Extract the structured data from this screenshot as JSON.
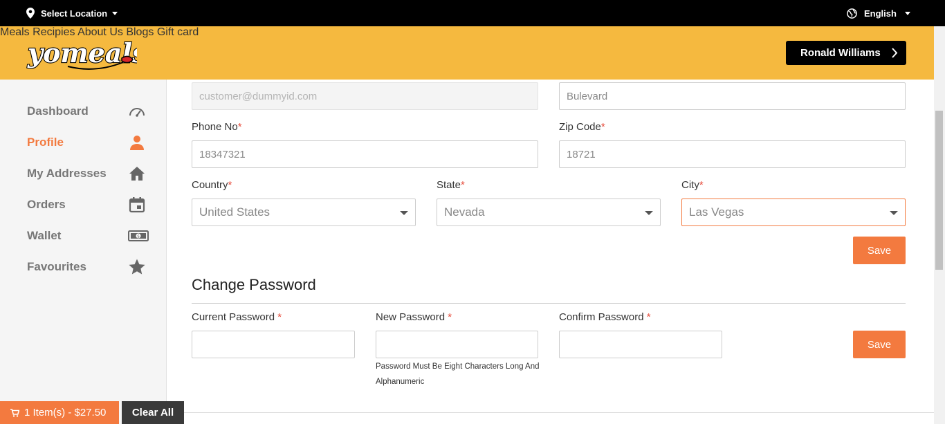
{
  "topbar": {
    "location_label": "Select Location",
    "language": "English"
  },
  "header": {
    "nav": [
      "Meals",
      "Recipies",
      "About Us",
      "Blogs",
      "Gift card"
    ],
    "user_name": "Ronald Williams"
  },
  "sidebar": {
    "items": [
      {
        "label": "Dashboard",
        "icon": "speedometer-icon"
      },
      {
        "label": "Profile",
        "icon": "user-icon",
        "active": true
      },
      {
        "label": "My Addresses",
        "icon": "home-icon"
      },
      {
        "label": "Orders",
        "icon": "calendar-icon"
      },
      {
        "label": "Wallet",
        "icon": "cash-icon"
      },
      {
        "label": "Favourites",
        "icon": "star-icon"
      }
    ]
  },
  "profile": {
    "email_value": "customer@dummyid.com",
    "address_value": "Bulevard",
    "phone_label": "Phone No",
    "phone_value": "18347321",
    "zip_label": "Zip Code",
    "zip_value": "18721",
    "country_label": "Country",
    "country_value": "United States",
    "state_label": "State",
    "state_value": "Nevada",
    "city_label": "City",
    "city_value": "Las Vegas",
    "save_label": "Save"
  },
  "password": {
    "title": "Change Password",
    "current_label": "Current Password",
    "new_label": "New Password",
    "confirm_label": "Confirm Password",
    "hint": "Password Must Be Eight Characters Long And Alphanumeric",
    "save_label": "Save"
  },
  "cart": {
    "summary": "1 Item(s) - $27.50",
    "clear_label": "Clear All"
  },
  "colors": {
    "accent": "#f37a3f",
    "header": "#f5b93f",
    "topbar": "#000000"
  }
}
